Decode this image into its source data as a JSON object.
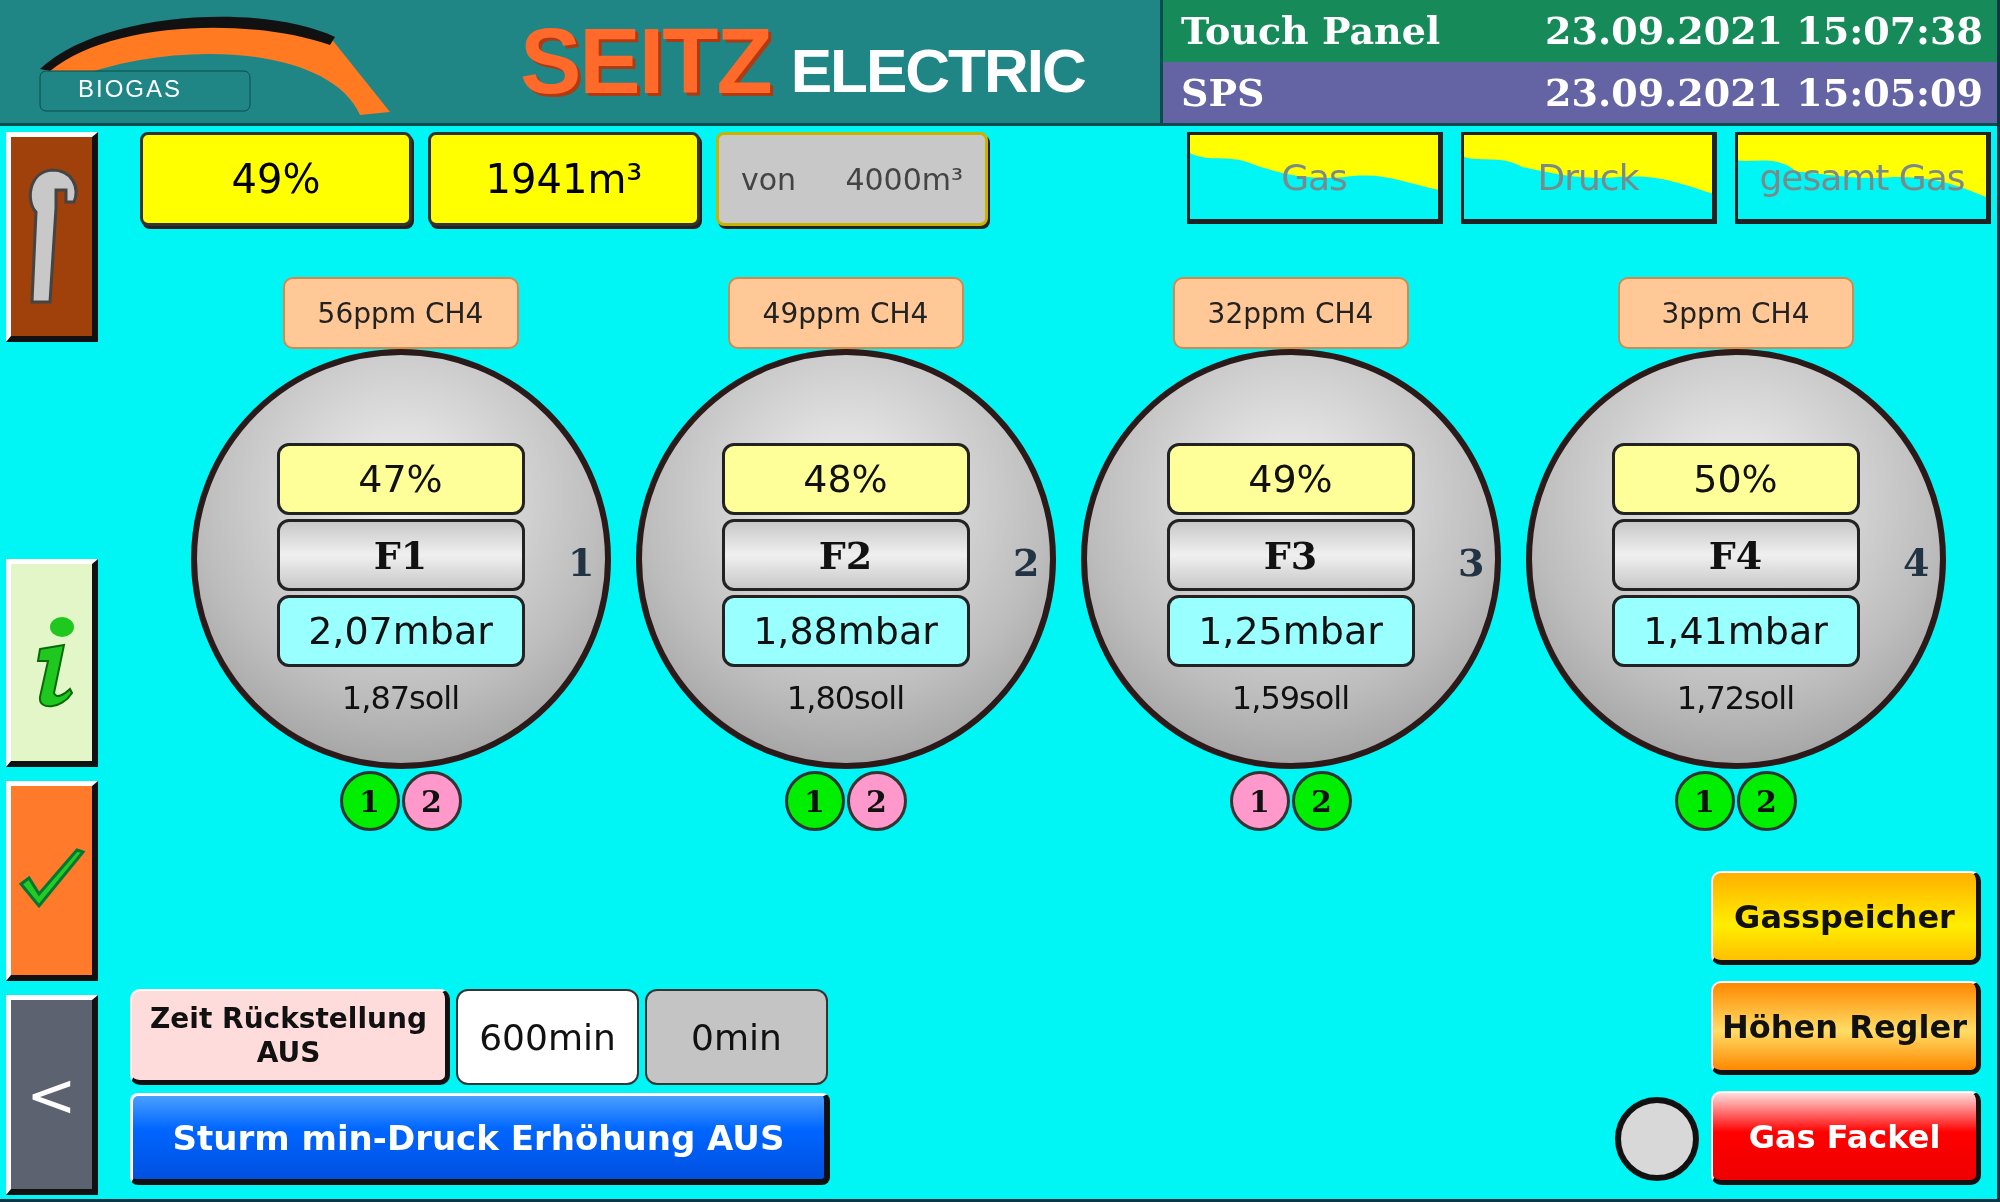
{
  "header": {
    "logo": {
      "brand": "BIOGAS",
      "name": "SEITZ",
      "suffix": "ELECTRIC"
    },
    "clocks": [
      {
        "kind": "panel",
        "label": "Touch Panel",
        "time": "23.09.2021 15:07:38"
      },
      {
        "kind": "plc",
        "label": "SPS",
        "time": "23.09.2021 15:05:09"
      }
    ]
  },
  "sidebar": {
    "top": [
      {
        "kind": "wrench"
      }
    ],
    "bottom": [
      {
        "kind": "info"
      },
      {
        "kind": "check"
      },
      {
        "kind": "back",
        "label": "<"
      }
    ]
  },
  "summary": [
    {
      "kind": "value",
      "text": "49%"
    },
    {
      "kind": "value",
      "text": "1941m³"
    },
    {
      "kind": "total",
      "prefix": "von",
      "text": "4000m³"
    }
  ],
  "chart_buttons": [
    {
      "label": "Gas"
    },
    {
      "label": "Druck"
    },
    {
      "label": "gesamt Gas"
    }
  ],
  "storages": [
    {
      "methane": "56ppm CH4",
      "fill": "47%",
      "name": "F1",
      "pressure": "2,07mbar",
      "setpoint": "1,87soll",
      "number": "1",
      "dots": [
        {
          "label": "1",
          "color": "#00ee00"
        },
        {
          "label": "2",
          "color": "#ff99cc"
        }
      ]
    },
    {
      "methane": "49ppm CH4",
      "fill": "48%",
      "name": "F2",
      "pressure": "1,88mbar",
      "setpoint": "1,80soll",
      "number": "2",
      "dots": [
        {
          "label": "1",
          "color": "#00ee00"
        },
        {
          "label": "2",
          "color": "#ff99cc"
        }
      ]
    },
    {
      "methane": "32ppm CH4",
      "fill": "49%",
      "name": "F3",
      "pressure": "1,25mbar",
      "setpoint": "1,59soll",
      "number": "3",
      "dots": [
        {
          "label": "1",
          "color": "#ff99cc"
        },
        {
          "label": "2",
          "color": "#00ee00"
        }
      ]
    },
    {
      "methane": "3ppm CH4",
      "fill": "50%",
      "name": "F4",
      "pressure": "1,41mbar",
      "setpoint": "1,72soll",
      "number": "4",
      "dots": [
        {
          "label": "1",
          "color": "#00ee00"
        },
        {
          "label": "2",
          "color": "#00ee00"
        }
      ]
    }
  ],
  "reset_timer": {
    "label": "Zeit Rückstellung AUS",
    "preset": "600min",
    "elapsed": "0min"
  },
  "storm_button": {
    "label": "Sturm min-Druck Erhöhung AUS"
  },
  "nav_buttons": [
    {
      "kind": "storage",
      "label": "Gasspeicher"
    },
    {
      "kind": "height",
      "label": "Höhen Regler"
    },
    {
      "kind": "flare",
      "label": "Gas Fackel"
    }
  ],
  "flare_lamp": {
    "on": false
  }
}
